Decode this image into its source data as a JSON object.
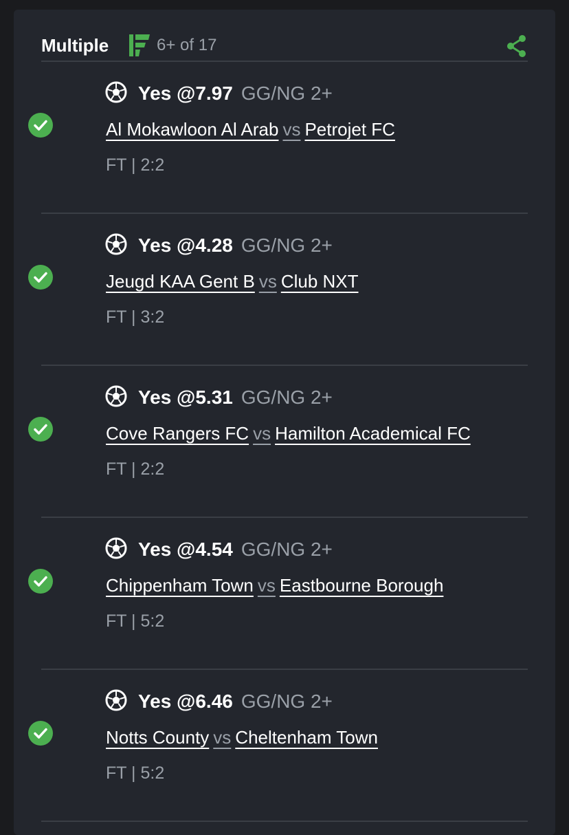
{
  "header": {
    "title": "Multiple",
    "count": "6+ of 17",
    "logo_icon": "bookmaker-logo-icon",
    "share_icon": "share-icon",
    "accent": "#4caf50"
  },
  "bets": [
    {
      "status": "won",
      "pick": "Yes @7.97",
      "market": "GG/NG 2+",
      "home": "Al Mokawloon Al Arab",
      "vs": "vs",
      "away": "Petrojet FC",
      "result": "FT | 2:2"
    },
    {
      "status": "won",
      "pick": "Yes @4.28",
      "market": "GG/NG 2+",
      "home": "Jeugd KAA Gent B",
      "vs": "vs",
      "away": "Club NXT",
      "result": "FT | 3:2"
    },
    {
      "status": "won",
      "pick": "Yes @5.31",
      "market": "GG/NG 2+",
      "home": "Cove Rangers FC",
      "vs": "vs",
      "away": "Hamilton Academical FC",
      "result": "FT | 2:2"
    },
    {
      "status": "won",
      "pick": "Yes @4.54",
      "market": "GG/NG 2+",
      "home": "Chippenham Town",
      "vs": "vs",
      "away": "Eastbourne Borough",
      "result": "FT | 5:2"
    },
    {
      "status": "won",
      "pick": "Yes @6.46",
      "market": "GG/NG 2+",
      "home": "Notts County",
      "vs": "vs",
      "away": "Cheltenham Town",
      "result": "FT | 5:2"
    }
  ]
}
